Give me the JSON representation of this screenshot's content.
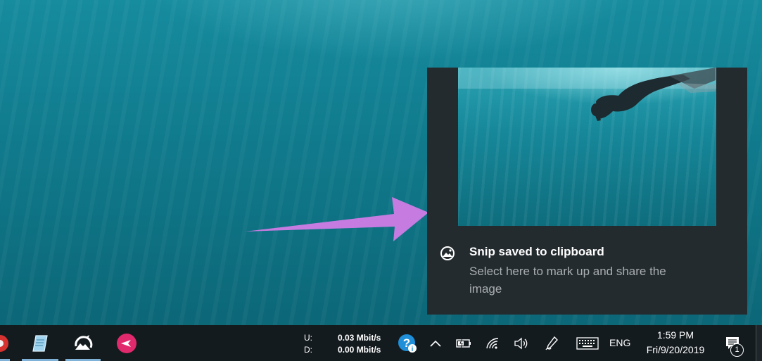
{
  "toast": {
    "title": "Snip saved to clipboard",
    "body": "Select here to mark up and share the image"
  },
  "taskbar": {
    "apps": [
      {
        "name": "red-app-icon",
        "pinned": true
      },
      {
        "name": "notepad-icon",
        "pinned": true
      },
      {
        "name": "snip-sketch-icon",
        "pinned": true
      },
      {
        "name": "pink-app-icon",
        "pinned": true
      }
    ],
    "net_meter": {
      "upload_label": "U:",
      "download_label": "D:",
      "upload_value": "0.03 Mbit/s",
      "download_value": "0.00 Mbit/s"
    },
    "tray_icons": [
      "help-icon",
      "chevron-up-icon",
      "battery-icon",
      "wifi-icon",
      "volume-icon",
      "pen-icon",
      "keyboard-icon"
    ],
    "language": "ENG",
    "time": "1:59 PM",
    "date": "Fri/9/20/2019",
    "notifications_count": "1"
  },
  "colors": {
    "arrow": "#c57be0",
    "toast_bg": "#242b2f",
    "taskbar_bg": "#141b1f",
    "accent_underline": "#7fb2d6"
  }
}
